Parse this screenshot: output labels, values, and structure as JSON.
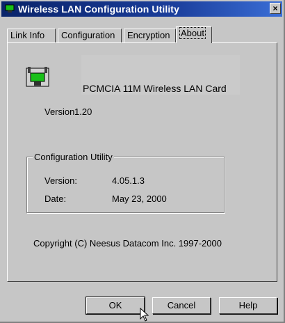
{
  "window": {
    "title": "Wireless LAN Configuration Utility",
    "close_glyph": "×"
  },
  "tabs": [
    {
      "label": "Link Info"
    },
    {
      "label": "Configuration"
    },
    {
      "label": "Encryption"
    },
    {
      "label": "About",
      "active": true
    }
  ],
  "about": {
    "product_name": "PCMCIA 11M Wireless LAN Card",
    "version_label": "Version",
    "version_value": "1.20",
    "group_title": "Configuration Utility",
    "rows": [
      {
        "label": "Version:",
        "value": "4.05.1.3"
      },
      {
        "label": "Date:",
        "value": "May 23, 2000"
      }
    ],
    "copyright": "Copyright (C) Neesus Datacom Inc. 1997-2000"
  },
  "buttons": {
    "ok": "OK",
    "cancel": "Cancel",
    "help": "Help"
  },
  "icons": {
    "app": "network-card-icon",
    "device": "network-card-icon",
    "cursor": "mouse-pointer-icon"
  },
  "colors": {
    "titlebar": "#0a246a",
    "face": "#c6c6c6",
    "icon_green": "#18c018"
  }
}
